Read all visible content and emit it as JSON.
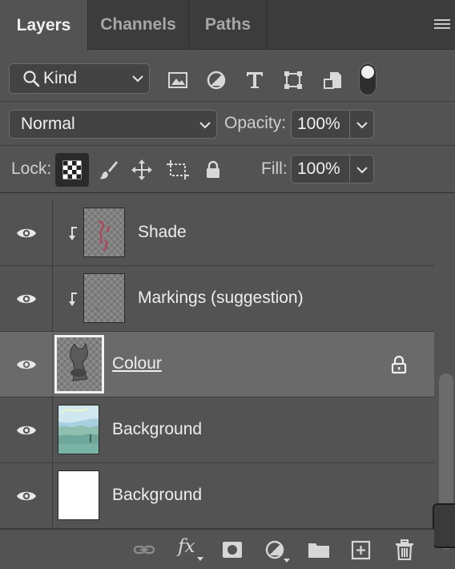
{
  "tabs": [
    {
      "label": "Layers",
      "active": true
    },
    {
      "label": "Channels",
      "active": false
    },
    {
      "label": "Paths",
      "active": false
    }
  ],
  "filter": {
    "kind_label": "Kind",
    "icons": [
      "image-filter-icon",
      "adjustment-filter-icon",
      "type-filter-icon",
      "shape-filter-icon",
      "smart-object-filter-icon"
    ],
    "filter_toggle_on": true
  },
  "blend": {
    "mode": "Normal",
    "opacity_label": "Opacity:",
    "opacity_value": "100%"
  },
  "lock": {
    "label": "Lock:",
    "icons": [
      "lock-transparent-pixels-icon",
      "lock-image-pixels-icon",
      "lock-position-icon",
      "lock-artboard-icon",
      "lock-all-icon"
    ],
    "active": "lock-transparent-pixels-icon",
    "fill_label": "Fill:",
    "fill_value": "100%"
  },
  "layers": [
    {
      "name": "Shade",
      "visible": true,
      "clipped": true,
      "selected": false,
      "locked": false
    },
    {
      "name": "Markings (suggestion)",
      "visible": true,
      "clipped": true,
      "selected": false,
      "locked": false
    },
    {
      "name": "Colour",
      "visible": true,
      "clipped": false,
      "selected": true,
      "locked": true
    },
    {
      "name": "Background",
      "visible": true,
      "clipped": false,
      "selected": false,
      "locked": false
    },
    {
      "name": "Background",
      "visible": true,
      "clipped": false,
      "selected": false,
      "locked": false
    }
  ],
  "bottom_bar": {
    "icons": [
      "link-layers-icon",
      "fx-icon",
      "layer-mask-icon",
      "adjustment-layer-icon",
      "group-folder-icon",
      "new-layer-icon",
      "trash-icon"
    ],
    "fx_label": "fx"
  },
  "colors": {
    "panel_bg": "#535353",
    "tab_bar_bg": "#3c3c3c",
    "selected_row": "#6a6a6a"
  }
}
